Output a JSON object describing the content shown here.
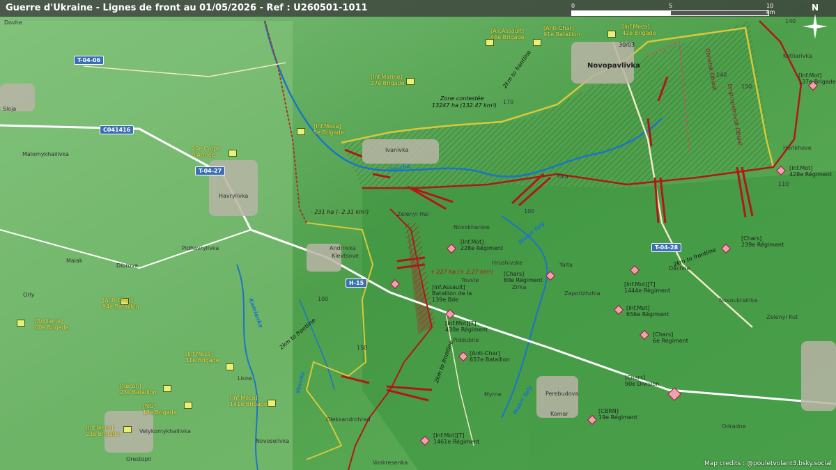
{
  "title": "Guerre d'Ukraine - Lignes de front au 01/05/2026 - Ref : U260501-1011",
  "scale": {
    "start": "0",
    "mid": "5",
    "end": "10 km"
  },
  "north": "N",
  "credits": "Map credits : @pouletvolant3.bsky.social",
  "colors": {
    "ua_front": "#d8c93a",
    "ru_front": "#b01818",
    "contested": "#3f8a3c",
    "road": "#ffffff"
  },
  "roads": [
    "T-04-06",
    "C041416",
    "T-04-27",
    "T-04-28",
    "H-15"
  ],
  "towns": [
    "Dovhe",
    "Sloja",
    "Malomykhailivka",
    "Havrylivka",
    "Pidhavrylivka",
    "Dibrova",
    "Maiak",
    "Orly",
    "Oleksandrohrad",
    "Novoselivka",
    "Velykomykhailivka",
    "Orestopil",
    "Ivanivka",
    "Zelenyi Hai",
    "Novokharske",
    "Andriivka",
    "Klevtsove",
    "Hrushivske",
    "Tovste",
    "Zirka",
    "Yalta",
    "Zaporizhzhia",
    "Dachne",
    "Novoukrainka",
    "Zelenyi Kut",
    "Piddubne",
    "Myrne",
    "Perebudova",
    "Komar",
    "Odradne",
    "Voskresenka",
    "Novopavlivka",
    "Kotliarivka",
    "Horikhove",
    "Filia",
    "Lisne"
  ],
  "rivers": [
    "Vovcha",
    "Mokri Yaly",
    "Kamianka"
  ],
  "notes": {
    "zone": "Zone contestée",
    "zone_area": "13247 ha (132.47 km²)",
    "minus": "- 231 ha (- 2.31 km²)",
    "plus": "+ 227 ha (+ 2.27 km²)",
    "front1": "2km to frontline",
    "front2": "2km to frontline",
    "front3": "2km to frontline",
    "front4": "2km to frontline",
    "oblast1": "Donetsk Oblast",
    "oblast2": "Dnipropetrovsk Oblast",
    "date": "30/03"
  },
  "units_ua": [
    {
      "label": "[Inf.Meca]",
      "name": "42e Brigade"
    },
    {
      "label": "[Air.Assault]",
      "name": "46e Brigade"
    },
    {
      "label": "[Anti-Char]",
      "name": "91e Bataillon"
    },
    {
      "label": "[Inf.Marine]",
      "name": "37e Brigade"
    },
    {
      "label": "[Inf.Meca]",
      "name": "5e Brigade"
    },
    {
      "label": "20e Corps",
      "name": "d'Armée"
    },
    {
      "label": "[Anti-Char]",
      "name": "94e Bataillon"
    },
    {
      "label": "[Artillerie]",
      "name": "60e Brigade"
    },
    {
      "label": "[Inf.Meca]",
      "name": "31e Brigade"
    },
    {
      "label": "[Recon]",
      "name": "23e Bataillon"
    },
    {
      "label": "[NG]",
      "name": "17e Brigade"
    },
    {
      "label": "[Inf.Meca]",
      "name": "141e Brigade"
    },
    {
      "label": "[Inf.Meca]",
      "name": "23e Brigade"
    }
  ],
  "units_ru": [
    {
      "label": "[Inf.Mot]",
      "name": "137e Brigade"
    },
    {
      "label": "[Inf.Mot]",
      "name": "428e Régiment"
    },
    {
      "label": "[Chars]",
      "name": "239e Régiment"
    },
    {
      "label": "[Inf.Mot]",
      "name": "228e Régiment"
    },
    {
      "label": "[Chars]",
      "name": "80e Régiment"
    },
    {
      "label": "[Inf.Mot][T]",
      "name": "1444e Régiment"
    },
    {
      "label": "[Inf.Mot]",
      "name": "656e Régiment"
    },
    {
      "label": "[Chars]",
      "name": "6e Régiment"
    },
    {
      "label": "[Inf.Assault]",
      "name": "Bataillon de la 139e Bde"
    },
    {
      "label": "[Inf.Mot][T]",
      "name": "430e Régiment"
    },
    {
      "label": "[Anti-Char]",
      "name": "657e Bataillon"
    },
    {
      "label": "[Chars]",
      "name": "90e Division"
    },
    {
      "label": "[CBRN]",
      "name": "19e Régiment"
    },
    {
      "label": "[Inf.Mot][T]",
      "name": "1461e Régiment"
    }
  ],
  "elevations": [
    "170",
    "150",
    "140",
    "150",
    "100",
    "110",
    "100",
    "150"
  ]
}
